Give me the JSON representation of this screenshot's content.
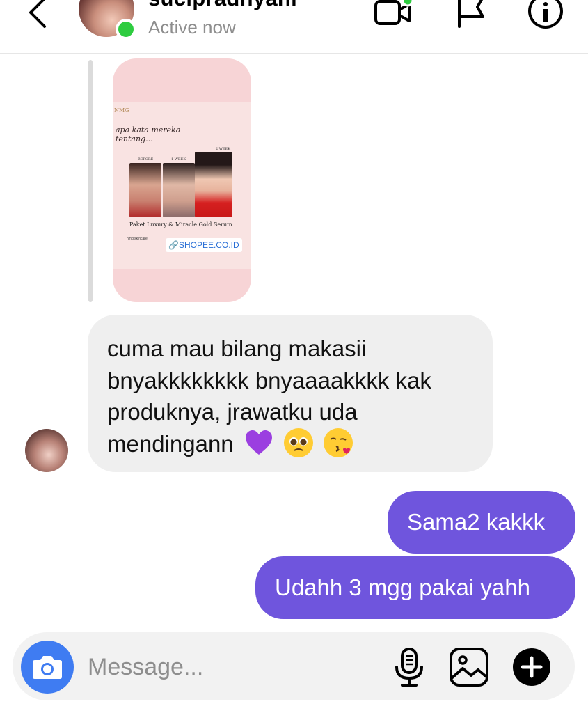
{
  "header": {
    "username": "sucipradnyani",
    "status": "Active now",
    "icons": [
      "back-chevron-icon",
      "video-call-icon",
      "report-flag-icon",
      "info-icon"
    ]
  },
  "shared_post": {
    "logo_text": "NMG",
    "script_text": "apa kata mereka tentang...",
    "labels": {
      "before": "BEFORE",
      "week1": "1 WEEK",
      "week2": "2 WEEK"
    },
    "title": "Paket Luxury & Miracle Gold Serum",
    "handle": "nmg.skincare",
    "link_text": "SHOPEE.CO.ID"
  },
  "messages": {
    "incoming": {
      "text": "cuma mau bilang makasii bnyakkkkkkkk bnyaaaakkkk kak produknya, jrawatku uda mendingann",
      "emojis": [
        "purple-heart-emoji",
        "pleading-face-emoji",
        "face-blowing-kiss-emoji"
      ]
    },
    "outgoing": [
      {
        "text": "Sama2 kakkk"
      },
      {
        "text": "Udahh 3 mgg pakai yahh"
      }
    ]
  },
  "composer": {
    "placeholder": "Message...",
    "icons": [
      "camera-icon",
      "microphone-icon",
      "gallery-icon",
      "add-icon"
    ]
  },
  "colors": {
    "outgoing_bubble": "#6f55dd",
    "incoming_bubble": "#efefef",
    "camera_button": "#3f7cf2",
    "online": "#2ecc40"
  }
}
